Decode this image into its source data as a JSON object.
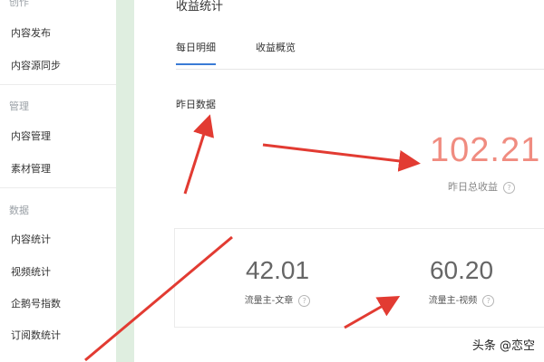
{
  "sidebar": {
    "sections": [
      {
        "title": "创作",
        "items": [
          "内容发布",
          "内容源同步"
        ]
      },
      {
        "title": "管理",
        "items": [
          "内容管理",
          "素材管理"
        ]
      },
      {
        "title": "数据",
        "items": [
          "内容统计",
          "视频统计",
          "企鹅号指数",
          "订阅数统计"
        ]
      }
    ]
  },
  "main": {
    "title": "收益统计",
    "tabs": [
      {
        "label": "每日明细",
        "active": true
      },
      {
        "label": "收益概览",
        "active": false
      }
    ],
    "section_label": "昨日数据",
    "total_value": "102.21",
    "total_label": "昨日总收益",
    "cards": [
      {
        "value": "42.01",
        "label": "流量主-文章"
      },
      {
        "value": "60.20",
        "label": "流量主-视频"
      }
    ],
    "help_glyph": "?"
  },
  "watermark": "头条 @恋空",
  "colors": {
    "accent": "#3a7bd5",
    "total_value": "#f08c80",
    "annotation_arrow": "#e23b32",
    "sidebar_strip": "#dfeee0"
  }
}
